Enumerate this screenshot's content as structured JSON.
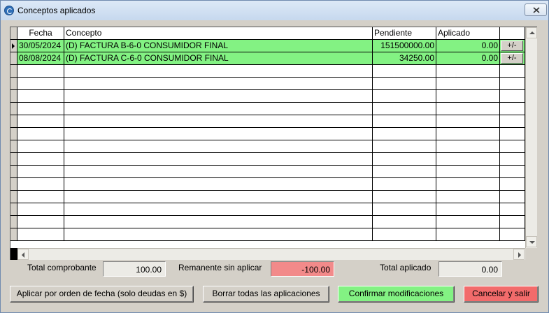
{
  "window": {
    "title": "Conceptos aplicados"
  },
  "grid": {
    "columns": [
      "Fecha",
      "Concepto",
      "Pendiente",
      "Aplicado",
      ""
    ],
    "rows": [
      {
        "fecha": "30/05/2024",
        "concepto": "(D) FACTURA B-6-0 CONSUMIDOR FINAL",
        "pendiente": "151500000.00",
        "aplicado": "0.00",
        "action": "+/-"
      },
      {
        "fecha": "08/08/2024",
        "concepto": "(D) FACTURA C-6-0 CONSUMIDOR FINAL",
        "pendiente": "34250.00",
        "aplicado": "0.00",
        "action": "+/-"
      }
    ],
    "row_color": "#83f283"
  },
  "totals": {
    "total_comprobante_label": "Total comprobante",
    "total_comprobante": "100.00",
    "remanente_label": "Remanente sin aplicar",
    "remanente": "-100.00",
    "total_aplicado_label": "Total aplicado",
    "total_aplicado": "0.00"
  },
  "buttons": {
    "aplicar": "Aplicar por orden de fecha (solo deudas en $)",
    "borrar": "Borrar todas las aplicaciones",
    "confirmar": "Confirmar modificaciones",
    "cancelar": "Cancelar y salir"
  },
  "colors": {
    "confirm": "#83f283",
    "cancel": "#f26b6b",
    "remanente": "#f28a8a"
  }
}
